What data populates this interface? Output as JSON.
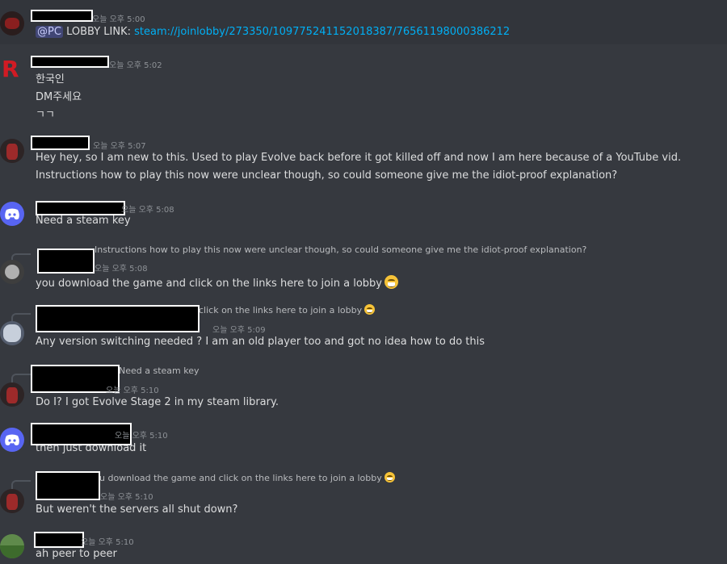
{
  "messages": [
    {
      "time": "오늘 오후 5:00",
      "lines": [],
      "mention": "@PC",
      "pretext": "LOBBY LINK: ",
      "link": "steam://joinlobby/273350/109775241152018387/76561198000386212"
    },
    {
      "time": "오늘 오후 5:02",
      "lines": [
        "한국인",
        "DM주세요",
        "ㄱㄱ"
      ]
    },
    {
      "time": "오늘 오후 5:07",
      "lines": [
        "Hey hey, so I am new to this. Used to play Evolve back before it got killed off and now I am here because of a YouTube vid.",
        "Instructions how to play this now were unclear though, so could someone give me the idiot-proof explanation?"
      ]
    },
    {
      "time": "오늘 오후 5:08",
      "lines": [
        "Need a steam key"
      ]
    },
    {
      "time": "오늘 오후 5:08",
      "reply": "Instructions how to play this now were unclear though, so could someone give me the idiot-proof explanation?",
      "lines": [
        "you download the game and click on the links here to join a lobby"
      ]
    },
    {
      "time": "오늘 오후 5:09",
      "reply": "click on the links here to join a lobby",
      "lines": [
        "Any version switching needed ? I am an old player too and got no idea how to do this"
      ]
    },
    {
      "time": "오늘 오후 5:10",
      "reply": "Need a steam key",
      "lines": [
        "Do I? I got Evolve Stage 2 in my steam library."
      ]
    },
    {
      "time": "오늘 오후 5:10",
      "lines": [
        "then just download it"
      ]
    },
    {
      "time": "오늘 오후 5:10",
      "reply": "u download the game and click on the links here to join a lobby",
      "lines": [
        "But weren't the servers all shut down?"
      ]
    },
    {
      "time": "오늘 오후 5:10",
      "lines": [
        "ah peer to peer"
      ]
    }
  ],
  "colors": {
    "background": "#36393f",
    "mention_bg": "#414675",
    "link": "#00aff4",
    "discord_blurple": "#5865f2"
  },
  "icons": {
    "emoji": "grinning-face-icon",
    "discord": "discord-logo-icon"
  }
}
